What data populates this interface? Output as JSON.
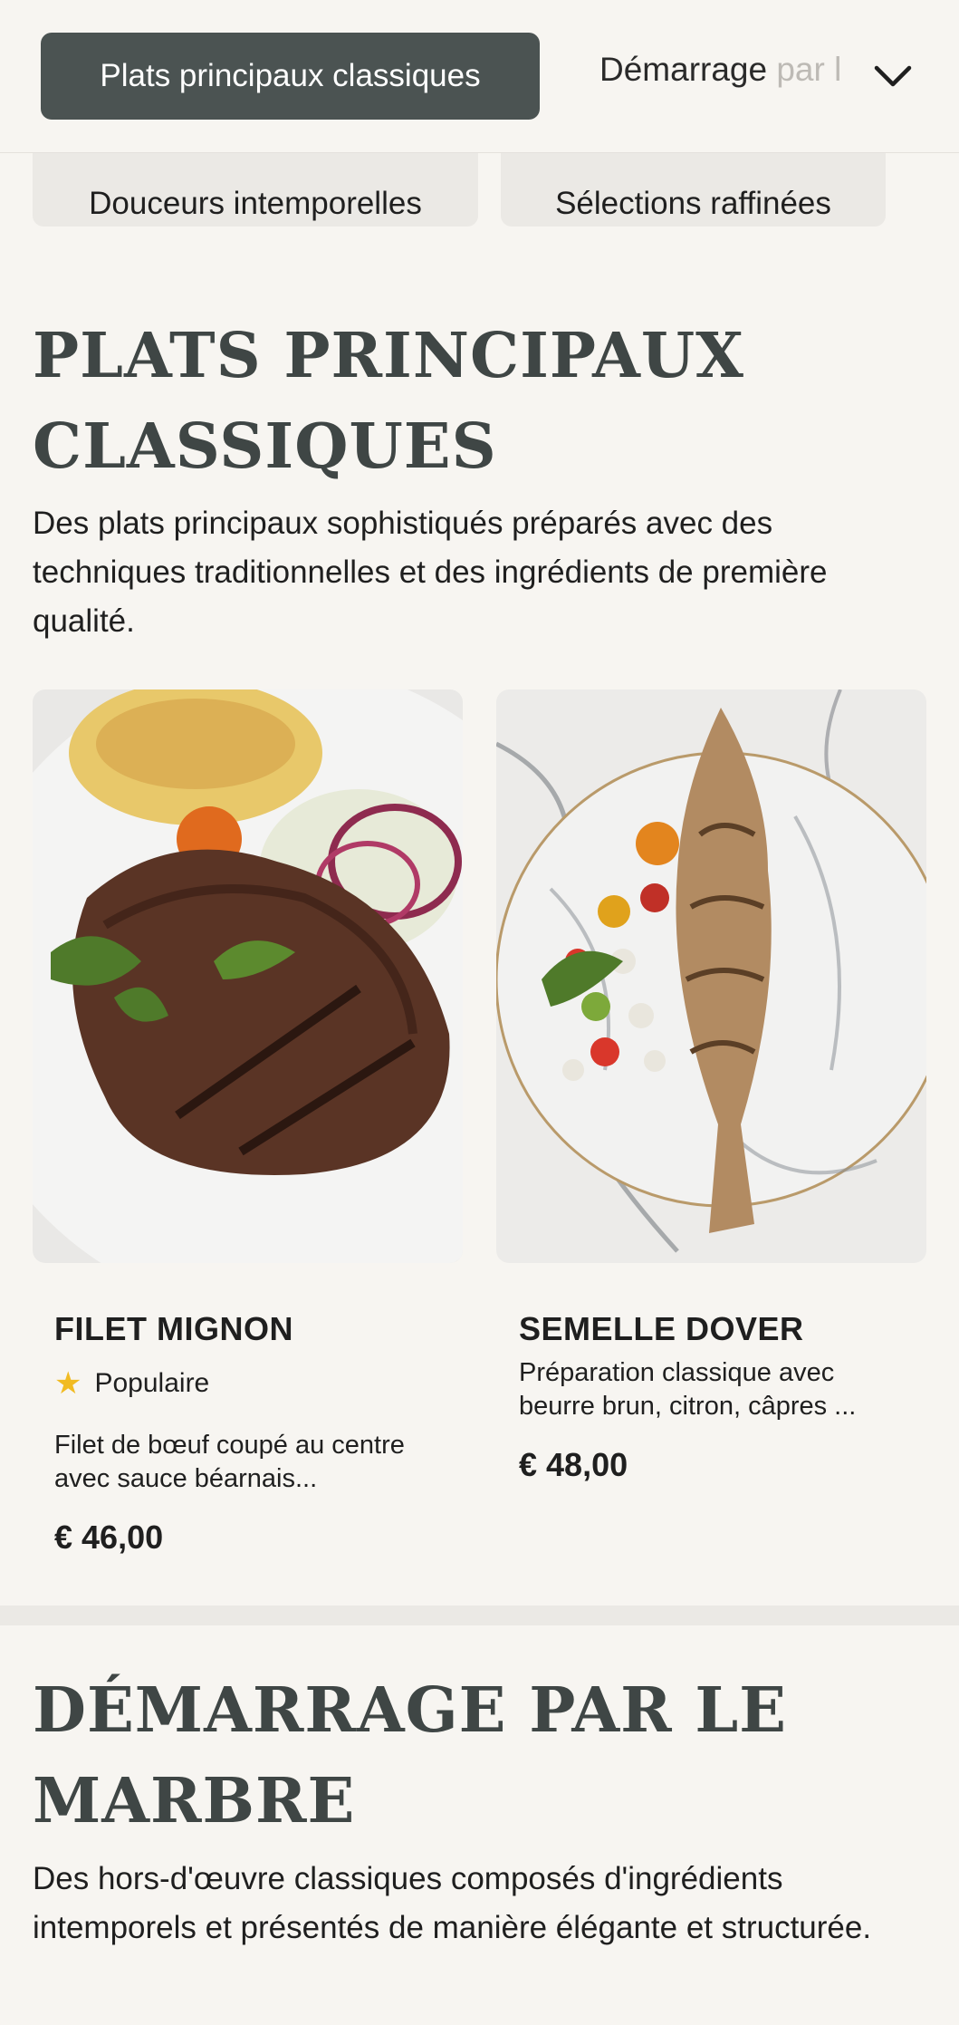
{
  "categories": {
    "active": "Plats principaux classiques",
    "next_visible": "Démarrage ",
    "next_faded": "par l",
    "row2": [
      "Douceurs intemporelles",
      "Sélections raffinées"
    ]
  },
  "sections": [
    {
      "title_line1": "PLATS PRINCIPAUX",
      "title_line2": "CLASSIQUES",
      "description": "Des plats principaux sophistiqués préparés avec des techniques traditionnelles et des ingrédients de première qualité.",
      "items": [
        {
          "name": "FILET MIGNON",
          "badge": "Populaire",
          "description": "Filet de bœuf coupé au centre avec sauce béarnais...",
          "price": "€ 46,00"
        },
        {
          "name": "SEMELLE DOVER",
          "description": "Préparation classique avec beurre brun, citron, câpres ...",
          "price": "€ 48,00"
        }
      ]
    },
    {
      "title_line1": "DÉMARRAGE PAR LE",
      "title_line2": "MARBRE",
      "description": "Des hors-d'œuvre classiques composés d'ingrédients intemporels et présentés de manière élégante et structurée."
    }
  ],
  "colors": {
    "background": "#f7f5f1",
    "active_chip": "#4b5352",
    "title": "#3f4645",
    "star": "#f1bb22"
  },
  "icons": [
    "chevron-down-icon",
    "star-icon"
  ]
}
